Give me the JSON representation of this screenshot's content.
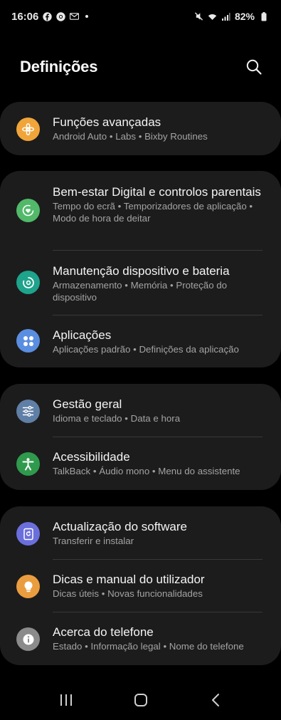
{
  "status_bar": {
    "time": "16:06",
    "battery": "82%"
  },
  "header": {
    "title": "Definições"
  },
  "items": [
    {
      "title": "Funções avançadas",
      "subtitle": "Android Auto  •  Labs  •  Bixby Routines",
      "icon": "star-icon",
      "color": "#f0a53a"
    },
    {
      "title": "Bem-estar Digital e controlos parentais",
      "subtitle": "Tempo do ecrã  •  Temporizadores de aplicação  •  Modo de hora de deitar",
      "icon": "wellbeing-icon",
      "color": "#52b96a"
    },
    {
      "title": "Manutenção dispositivo e bateria",
      "subtitle": "Armazenamento  •  Memória  •  Proteção do dispositivo",
      "icon": "device-care-icon",
      "color": "#1ea38c"
    },
    {
      "title": "Aplicações",
      "subtitle": "Aplicações padrão  •  Definições da aplicação",
      "icon": "apps-icon",
      "color": "#5a8ee0"
    },
    {
      "title": "Gestão geral",
      "subtitle": "Idioma e teclado  •  Data e hora",
      "icon": "sliders-icon",
      "color": "#5f7fa6"
    },
    {
      "title": "Acessibilidade",
      "subtitle": "TalkBack  •  Áudio mono  •  Menu do assistente",
      "icon": "accessibility-icon",
      "color": "#2f9a4d"
    },
    {
      "title": "Actualização do software",
      "subtitle": "Transferir e instalar",
      "icon": "update-icon",
      "color": "#6b6fdc"
    },
    {
      "title": "Dicas e manual do utilizador",
      "subtitle": "Dicas úteis  •  Novas funcionalidades",
      "icon": "lightbulb-icon",
      "color": "#ea9d3f"
    },
    {
      "title": "Acerca do telefone",
      "subtitle": "Estado  •  Informação legal  •  Nome do telefone",
      "icon": "info-icon",
      "color": "#8b8b8b"
    }
  ],
  "nav_bar": {
    "buttons": [
      "recents-icon",
      "home-icon",
      "back-icon"
    ]
  }
}
